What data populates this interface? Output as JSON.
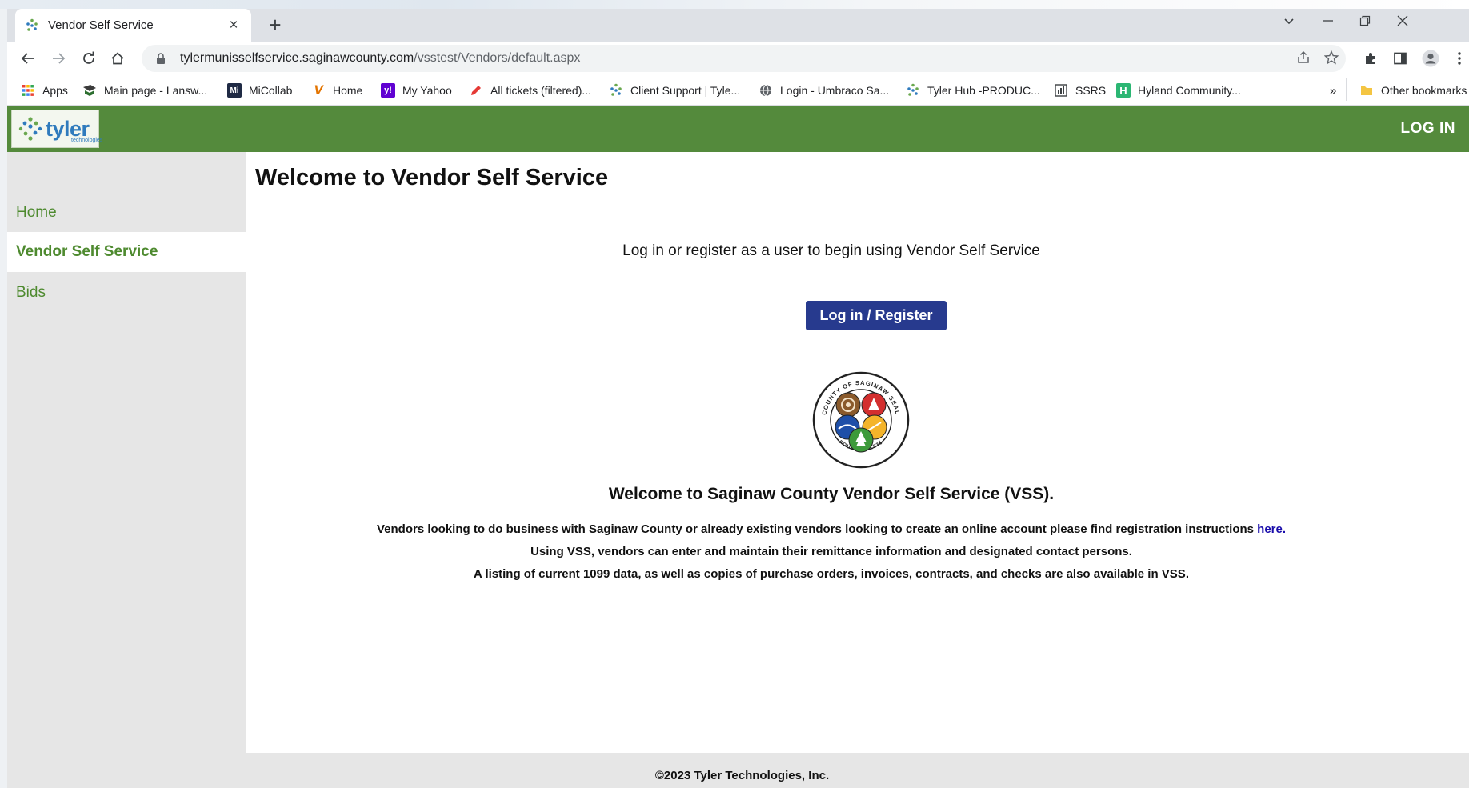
{
  "browser": {
    "tab_title": "Vendor Self Service",
    "tab_close": "×",
    "new_tab": "+",
    "url_domain": "tylermunisselfservice.saginawcounty.com",
    "url_path": "/vsstest/Vendors/default.aspx",
    "bookmarks": [
      {
        "label": "Apps",
        "icon": "apps-grid-icon"
      },
      {
        "label": "Main page - Lansw...",
        "icon": "lansweeper-icon"
      },
      {
        "label": "MiCollab",
        "icon": "micollab-icon"
      },
      {
        "label": "Home",
        "icon": "v-check-icon"
      },
      {
        "label": "My Yahoo",
        "icon": "yahoo-icon"
      },
      {
        "label": "All tickets (filtered)...",
        "icon": "pencil-icon"
      },
      {
        "label": "Client Support | Tyle...",
        "icon": "tyler-icon"
      },
      {
        "label": "Login - Umbraco Sa...",
        "icon": "globe-icon"
      },
      {
        "label": "Tyler Hub -PRODUC...",
        "icon": "tyler-icon"
      },
      {
        "label": "SSRS",
        "icon": "report-icon"
      },
      {
        "label": "Hyland Community...",
        "icon": "hyland-icon"
      }
    ],
    "overflow_label": "»",
    "other_bookmarks": "Other bookmarks"
  },
  "header": {
    "logo_text": "tyler",
    "logo_sub": "technologies",
    "login_label": "LOG IN"
  },
  "sidebar": {
    "items": [
      {
        "label": "Home"
      },
      {
        "label": "Vendor Self Service"
      },
      {
        "label": "Bids"
      }
    ]
  },
  "main": {
    "title": "Welcome to Vendor Self Service",
    "intro": "Log in or register as a user to begin using Vendor Self Service",
    "button_label": "Log in / Register",
    "seal_top_text": "COUNTY OF SAGINAW SEAL",
    "seal_bottom_text": "FOUNDED 1835",
    "headline": "Welcome to Saginaw County Vendor Self Service (VSS).",
    "para1": "Vendors looking to do business with Saginaw County or already existing vendors looking to create an online account please find registration instructions",
    "para1_link": " here.",
    "para2": "Using VSS, vendors can enter and maintain their remittance information and designated contact persons.",
    "para3": "A listing of current 1099 data, as well as copies of purchase orders, invoices, contracts, and checks are also available in VSS."
  },
  "footer": {
    "text": "©2023 Tyler Technologies, Inc."
  },
  "colors": {
    "header_green": "#548a3c",
    "sidebar_text": "#4e8a2f",
    "button_navy": "#273a8e",
    "title_rule": "#7fb5c9"
  }
}
